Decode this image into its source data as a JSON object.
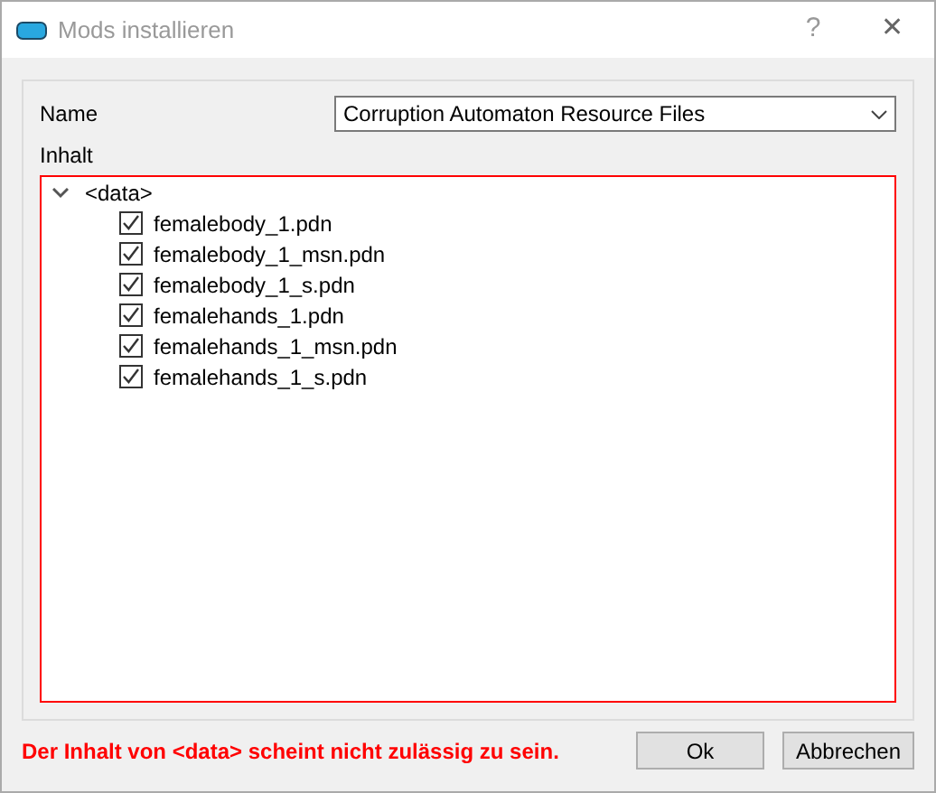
{
  "window": {
    "title": "Mods installieren",
    "buttons": [
      "?",
      "✕"
    ]
  },
  "name_field": {
    "label": "Name",
    "value": "Corruption Automaton Resource Files"
  },
  "content": {
    "label": "Inhalt",
    "invalid": true,
    "tree": [
      {
        "label": "<data>",
        "expanded": true,
        "children": [
          {
            "label": "femalebody_1.pdn",
            "checked": true
          },
          {
            "label": "femalebody_1_msn.pdn",
            "checked": true
          },
          {
            "label": "femalebody_1_s.pdn",
            "checked": true
          },
          {
            "label": "femalehands_1.pdn",
            "checked": true
          },
          {
            "label": "femalehands_1_msn.pdn",
            "checked": true
          },
          {
            "label": "femalehands_1_s.pdn",
            "checked": true
          }
        ]
      }
    ]
  },
  "error_message": "Der Inhalt von <data> scheint nicht zulässig zu sein.",
  "buttons": [
    "Ok",
    "Abbrechen"
  ]
}
